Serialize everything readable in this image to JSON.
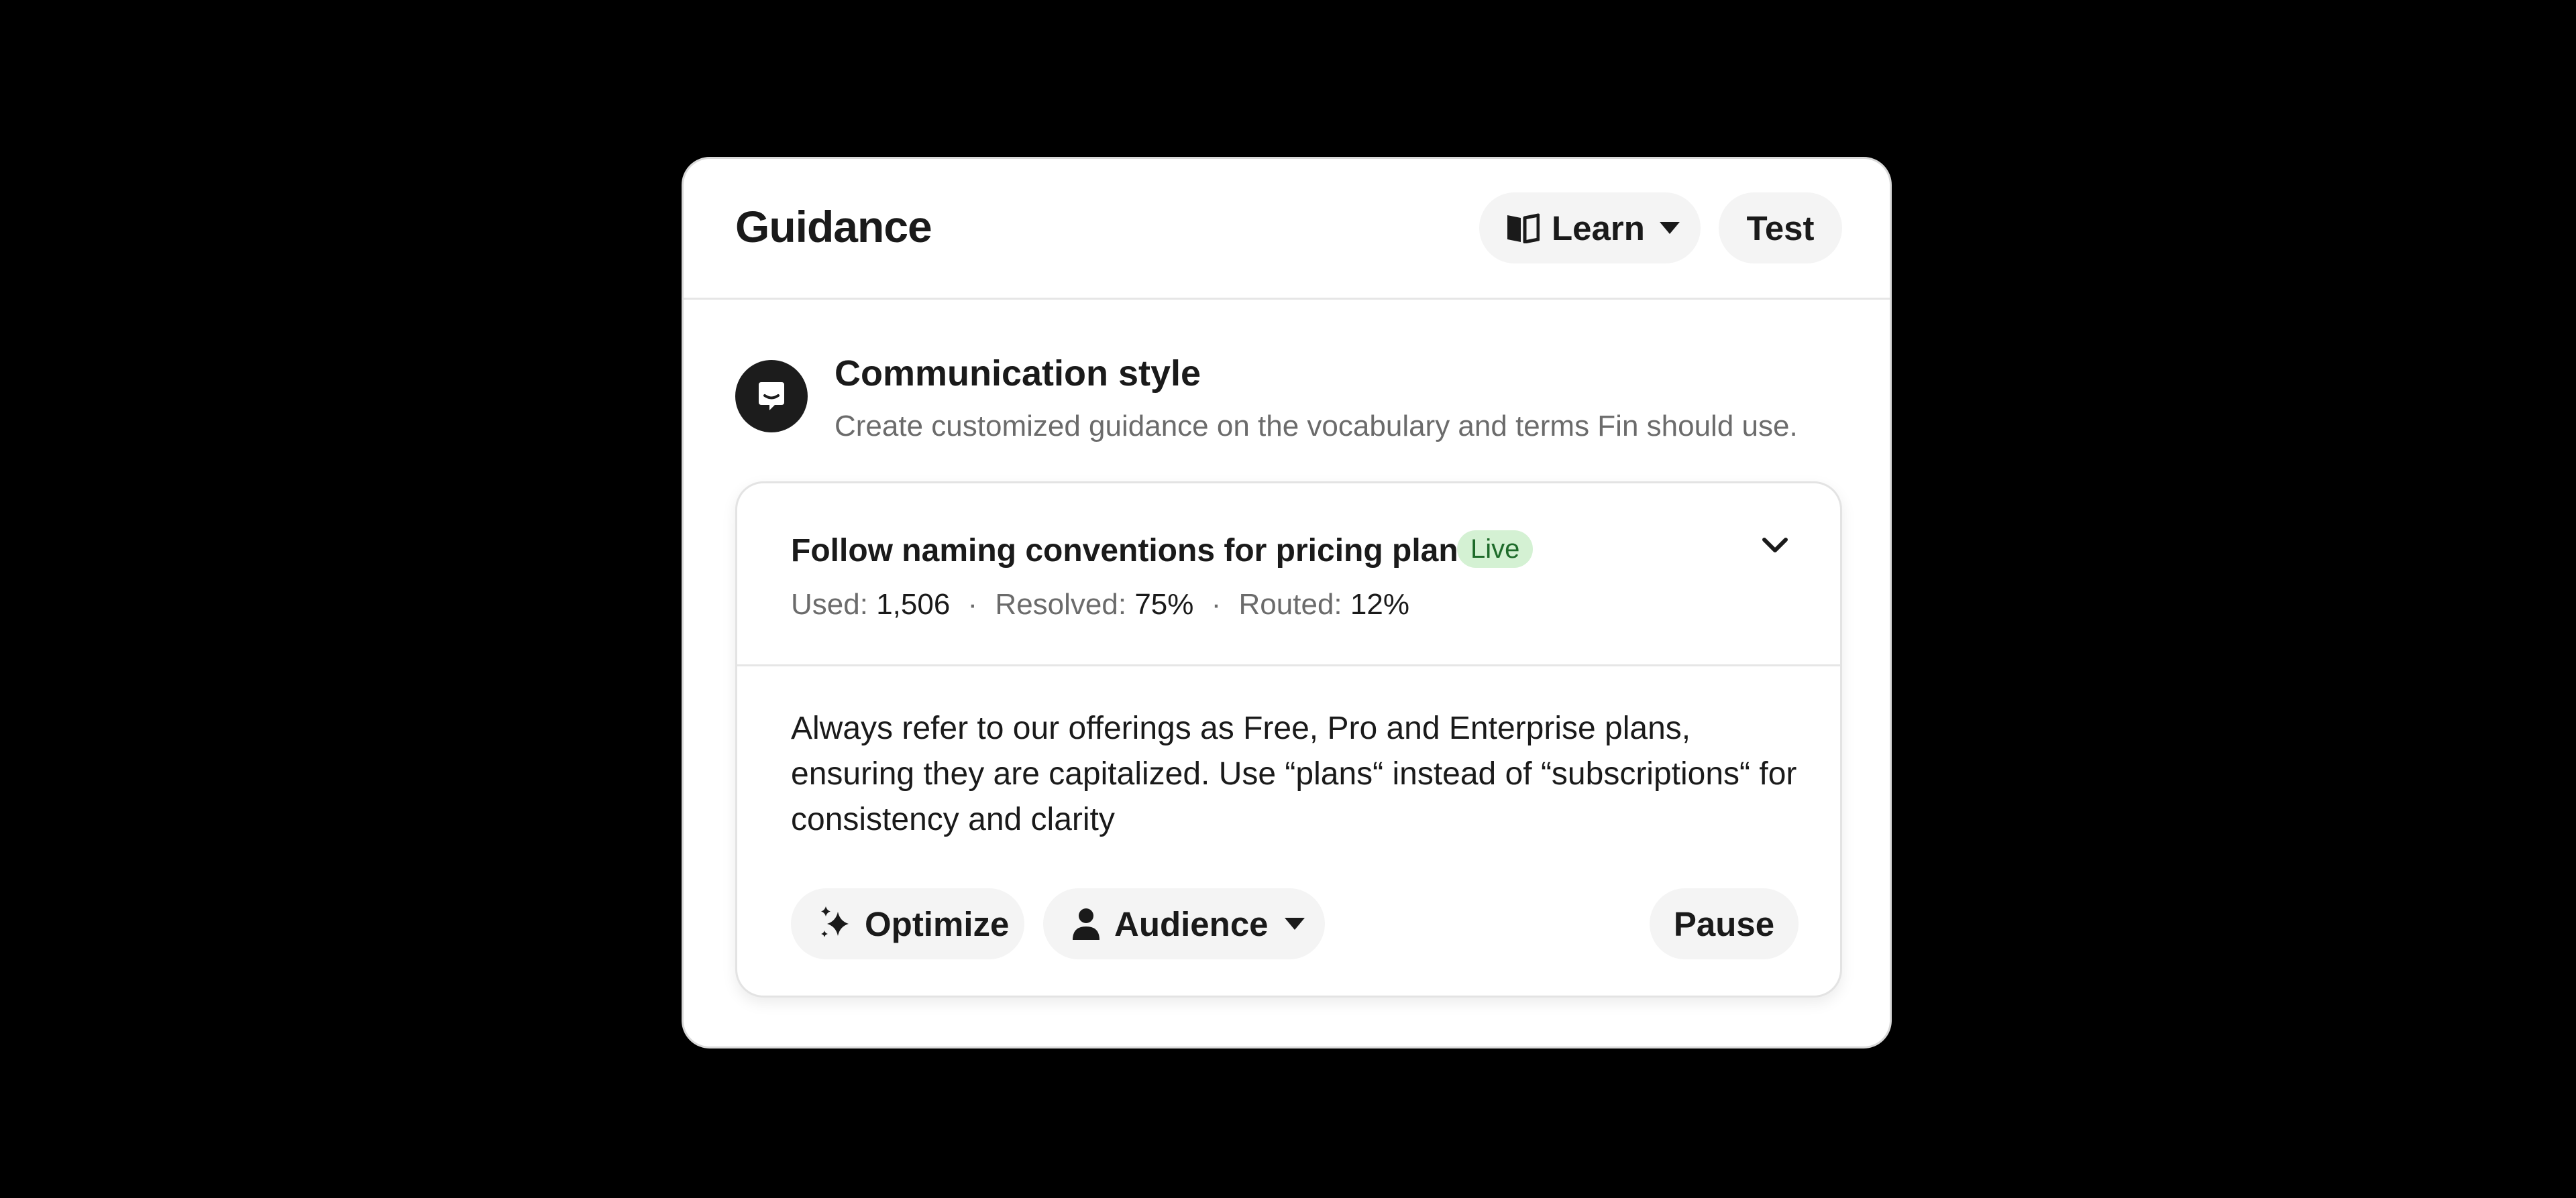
{
  "header": {
    "title": "Guidance",
    "learn_label": "Learn",
    "test_label": "Test"
  },
  "section": {
    "icon": "chat-bubble-icon",
    "title": "Communication style",
    "description": "Create customized guidance on the vocabulary and terms Fin should use."
  },
  "rule": {
    "title": "Follow naming conventions for pricing plans",
    "status": "Live",
    "stats": {
      "used_label": "Used:",
      "used_value": "1,506",
      "resolved_label": "Resolved:",
      "resolved_value": "75%",
      "routed_label": "Routed:",
      "routed_value": "12%",
      "separator": "·"
    },
    "body": "Always refer to our offerings as Free, Pro and Enterprise plans, ensuring they are capitalized. Use “plans“ instead of “subscriptions“ for consistency and clarity"
  },
  "actions": {
    "optimize_label": "Optimize",
    "audience_label": "Audience",
    "pause_label": "Pause"
  },
  "colors": {
    "background": "#000000",
    "card": "#ffffff",
    "pill": "#f4f4f4",
    "live_badge_bg": "#d4f1d3",
    "live_badge_text": "#1e6b2a",
    "muted_text": "#6b6b6b"
  }
}
